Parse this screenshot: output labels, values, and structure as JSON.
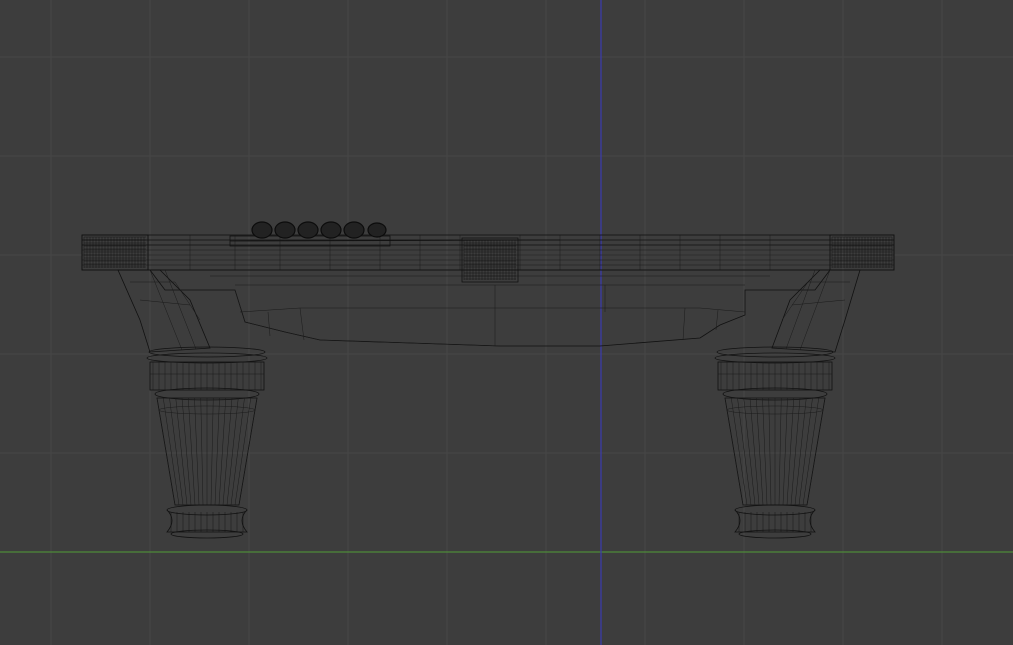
{
  "viewport": {
    "background_color": "#3d3d3d",
    "grid_color": "#474747",
    "x_axis_color": "#4e8a3a",
    "z_axis_color": "#3b3bb0",
    "wire_color": "#111111",
    "object": "billiard-table-wireframe",
    "view": "front-orthographic"
  }
}
